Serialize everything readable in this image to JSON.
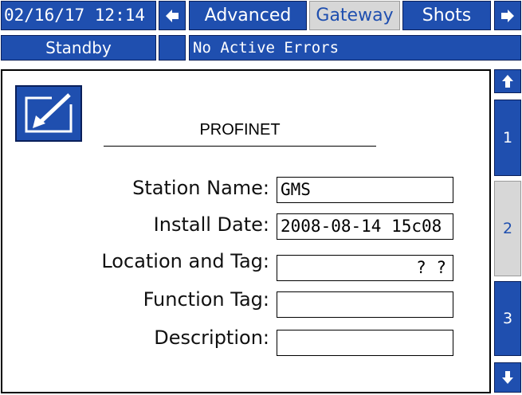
{
  "header": {
    "datetime": "02/16/17 12:14",
    "tabs": [
      {
        "label": "Advanced",
        "active": false
      },
      {
        "label": "Gateway",
        "active": true
      },
      {
        "label": "Shots",
        "active": false
      }
    ]
  },
  "status_bar": {
    "state": "Standby",
    "errors": "No Active Errors"
  },
  "main": {
    "title": "PROFINET",
    "fields": {
      "station_name": {
        "label": "Station Name:",
        "value": "GMS"
      },
      "install_date": {
        "label": "Install Date:",
        "value": "2008-08-14 15c08"
      },
      "location_tag": {
        "label": "Location and Tag:",
        "value": "? ?"
      },
      "function_tag": {
        "label": "Function Tag:",
        "value": ""
      },
      "description": {
        "label": "Description:",
        "value": ""
      }
    }
  },
  "side_nav": {
    "pages": [
      "1",
      "2",
      "3"
    ],
    "current_page": "2"
  },
  "colors": {
    "accent": "#1f4faf",
    "inactive": "#d7d7d7"
  }
}
